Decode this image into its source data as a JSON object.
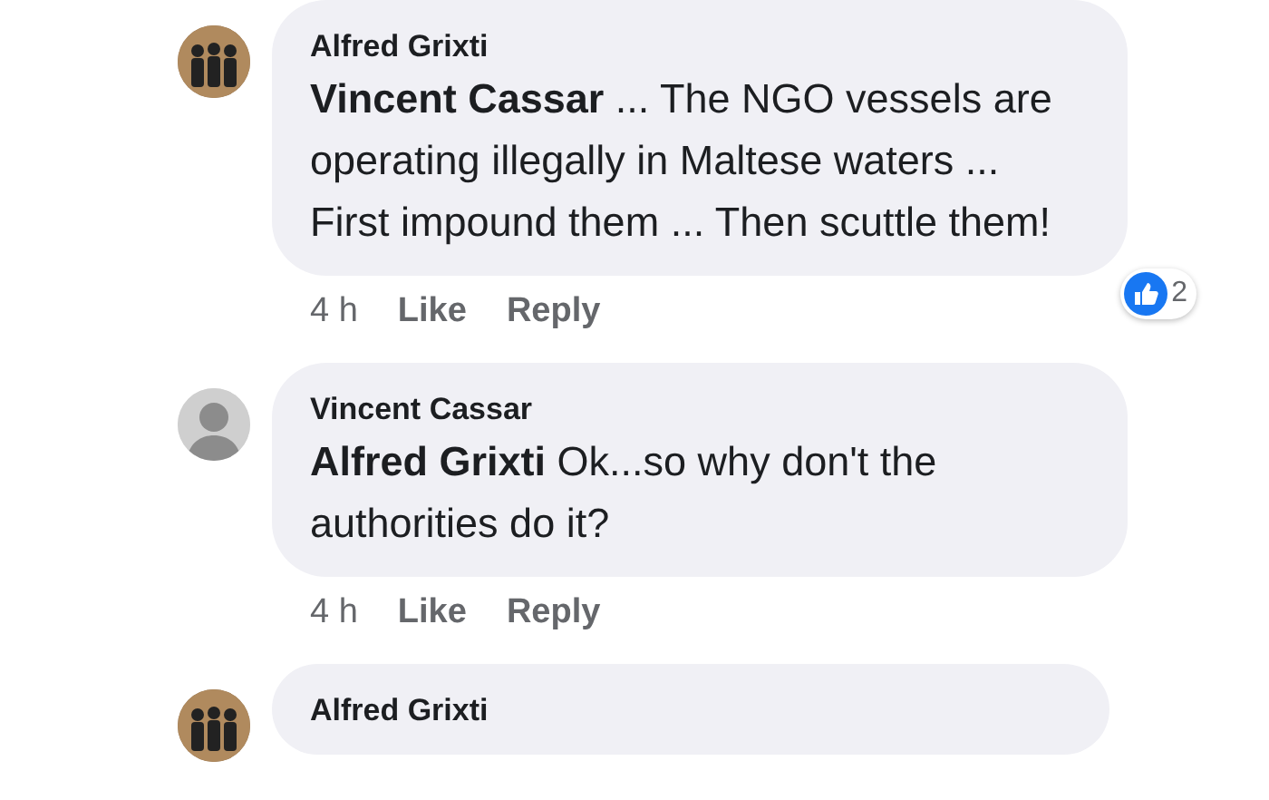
{
  "comments": [
    {
      "author": "Alfred Grixti",
      "kind": "group",
      "text": "**Vincent Cassar** ... The NGO vessels are operating illegally in Maltese waters ... First impound them ... Then scuttle them!",
      "time": "4 h",
      "like": "Like",
      "reply": "Reply",
      "reactions": "2"
    },
    {
      "author": "Vincent Cassar",
      "kind": "person",
      "text": "**Alfred Grixti** Ok...so why don't the authorities do it?",
      "time": "4 h",
      "like": "Like",
      "reply": "Reply"
    },
    {
      "author": "Alfred Grixti",
      "kind": "group"
    }
  ]
}
